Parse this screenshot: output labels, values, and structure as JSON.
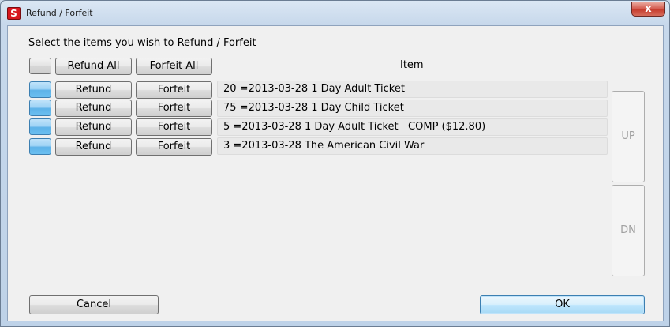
{
  "window": {
    "title": "Refund / Forfeit",
    "app_icon_letter": "S",
    "close_glyph": "x"
  },
  "prompt": "Select the items you wish to Refund / Forfeit",
  "header": {
    "refund_all": "Refund All",
    "forfeit_all": "Forfeit All",
    "item": "Item"
  },
  "rows": [
    {
      "refund": "Refund",
      "forfeit": "Forfeit",
      "item": "20 =2013-03-28 1 Day Adult Ticket"
    },
    {
      "refund": "Refund",
      "forfeit": "Forfeit",
      "item": "75 =2013-03-28 1 Day Child Ticket"
    },
    {
      "refund": "Refund",
      "forfeit": "Forfeit",
      "item": "5 =2013-03-28 1 Day Adult Ticket   COMP ($12.80)"
    },
    {
      "refund": "Refund",
      "forfeit": "Forfeit",
      "item": "3 =2013-03-28 The American Civil War"
    }
  ],
  "nav": {
    "up": "UP",
    "down": "DN"
  },
  "buttons": {
    "cancel": "Cancel",
    "ok": "OK"
  }
}
